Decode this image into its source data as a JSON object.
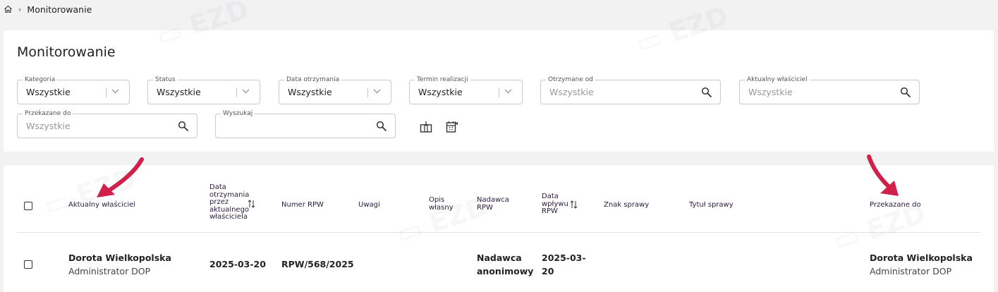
{
  "breadcrumb": {
    "home_icon": "home-icon",
    "separator": "›",
    "current": "Monitorowanie"
  },
  "page": {
    "title": "Monitorowanie"
  },
  "filters": {
    "kategoria": {
      "label": "Kategoria",
      "value": "Wszystkie"
    },
    "status": {
      "label": "Status",
      "value": "Wszystkie"
    },
    "data_otrzymania": {
      "label": "Data otrzymania",
      "value": "Wszystkie"
    },
    "termin_realizacji": {
      "label": "Termin realizacji",
      "value": "Wszystkie"
    },
    "otrzymane_od": {
      "label": "Otrzymane od",
      "placeholder": "Wszystkie"
    },
    "aktualny_wlasciciel": {
      "label": "Aktualny właściciel",
      "placeholder": "Wszystkie"
    },
    "przekazane_do": {
      "label": "Przekazane do",
      "placeholder": "Wszystkie"
    },
    "wyszukaj": {
      "label": "Wyszukaj",
      "placeholder": ""
    }
  },
  "tools": [
    "clear-filter-icon",
    "calendar-icon"
  ],
  "table": {
    "columns": {
      "owner": "Aktualny właściciel",
      "received_date_l1": "Data",
      "received_date_l2": "otrzymania",
      "received_date_l3": "przez",
      "received_date_l4": "aktualnego",
      "received_date_l5": "właściciela",
      "rpw": "Numer RPW",
      "notes": "Uwagi",
      "desc_l1": "Opis",
      "desc_l2": "własny",
      "sender_l1": "Nadawca",
      "sender_l2": "RPW",
      "inflow_l1": "Data",
      "inflow_l2": "wpływu",
      "inflow_l3": "RPW",
      "case_sign": "Znak sprawy",
      "case_title": "Tytuł sprawy",
      "forwarded_to": "Przekazane do"
    },
    "rows": [
      {
        "owner_name": "Dorota Wielkopolska",
        "owner_role": "Administrator DOP",
        "received_date": "2025-03-20",
        "rpw": "RPW/568/2025",
        "notes": "",
        "desc": "",
        "sender_l1": "Nadawca",
        "sender_l2": "anonimowy",
        "inflow_l1": "2025-03-",
        "inflow_l2": "20",
        "case_sign": "",
        "case_title": "",
        "forwarded_name": "Dorota Wielkopolska",
        "forwarded_role": "Administrator DOP"
      }
    ]
  },
  "colors": {
    "arrow": "#d0214a",
    "header_text": "#2a1a3a",
    "background": "#f2f2f3"
  }
}
